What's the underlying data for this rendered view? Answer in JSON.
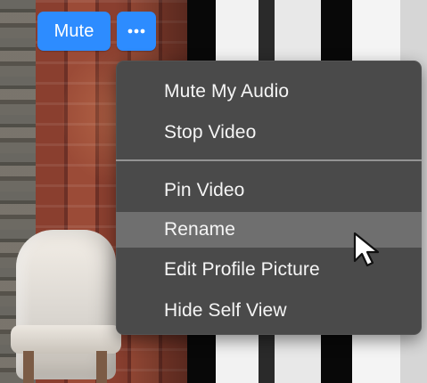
{
  "video_overlay": {
    "mute_button_label": "Mute",
    "more_button_icon": "more-options-icon",
    "accent_color": "#2d8cff"
  },
  "context_menu": {
    "items": [
      {
        "label": "Mute My Audio"
      },
      {
        "label": "Stop Video"
      },
      {
        "label": "Pin Video"
      },
      {
        "label": "Rename",
        "hovered": true
      },
      {
        "label": "Edit Profile Picture"
      },
      {
        "label": "Hide Self View"
      }
    ],
    "background_color": "#4a4a4a",
    "hover_color": "#6f6f6f",
    "text_color": "#f5f5f5"
  },
  "cursor": {
    "icon": "arrow-cursor-icon"
  }
}
